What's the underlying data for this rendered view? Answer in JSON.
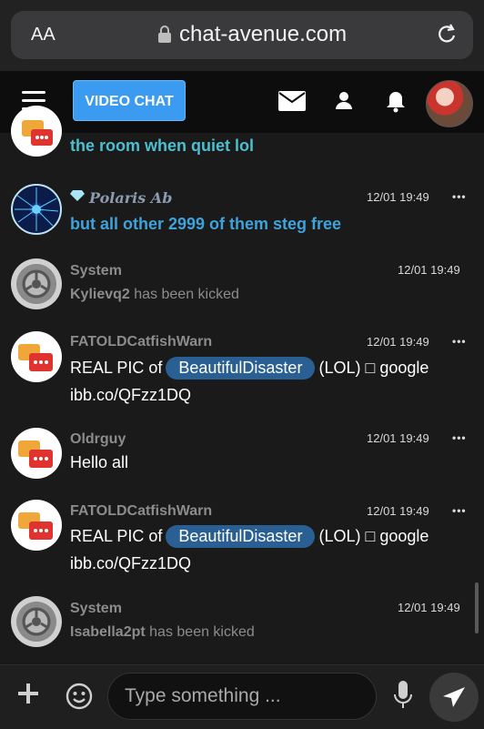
{
  "browser": {
    "aa_label": "AA",
    "url": "chat-avenue.com"
  },
  "header": {
    "video_chat_label": "VIDEO CHAT"
  },
  "messages": [
    {
      "username": "",
      "time": "",
      "text": "the room when quiet lol",
      "type": "partial"
    },
    {
      "username": "Polaris Ab",
      "time": "12/01 19:49",
      "text": "but all other 2999 of them steg free",
      "type": "polaris"
    },
    {
      "username": "System",
      "time": "12/01 19:49",
      "text_name": "Kylievq2",
      "text_rest": " has been kicked",
      "type": "system"
    },
    {
      "username": "FATOLDCatfishWarn",
      "time": "12/01 19:49",
      "text_pre": "REAL PIC of",
      "mention": "BeautifulDisaster",
      "text_post": "(LOL) □ google",
      "line2": "ibb.co/QFzz1DQ",
      "type": "chat"
    },
    {
      "username": "Oldrguy",
      "time": "12/01 19:49",
      "text": "Hello all",
      "type": "chat"
    },
    {
      "username": "FATOLDCatfishWarn",
      "time": "12/01 19:49",
      "text_pre": "REAL PIC of",
      "mention": "BeautifulDisaster",
      "text_post": "(LOL) □ google",
      "line2": "ibb.co/QFzz1DQ",
      "type": "chat"
    },
    {
      "username": "System",
      "time": "12/01 19:49",
      "text_name": "Isabella2pt",
      "text_rest": " has been kicked",
      "type": "system"
    }
  ],
  "input": {
    "placeholder": "Type something ..."
  },
  "menu_dots": "•••",
  "icons": [
    "lock-icon",
    "reload-icon",
    "menu-icon",
    "mail-icon",
    "user-icon",
    "bell-icon",
    "plus-icon",
    "emoji-icon",
    "mic-icon",
    "send-icon",
    "chat-bubbles-icon",
    "gear-icon"
  ],
  "colors": {
    "video_button": "#3a9bf0",
    "mention_bg": "#2a5f94",
    "teal_text": "#4bbfd0",
    "blue_text": "#3fa2db"
  }
}
